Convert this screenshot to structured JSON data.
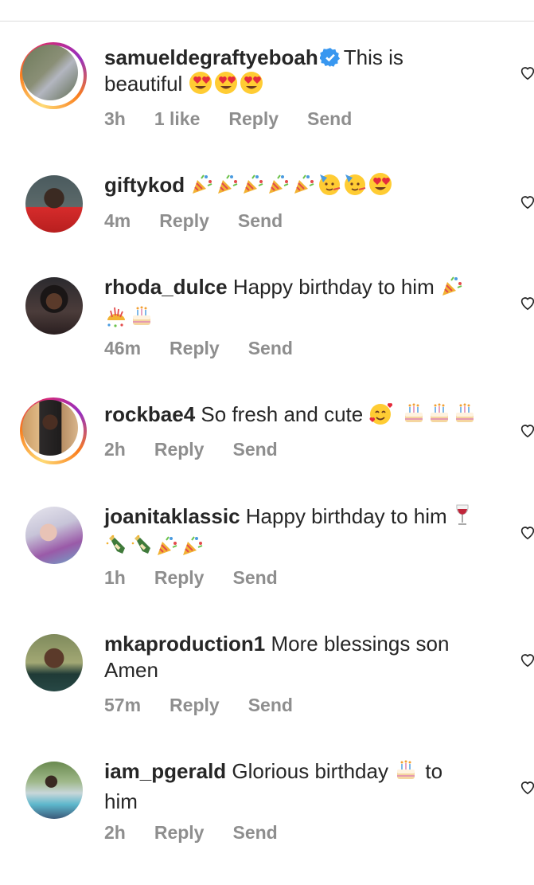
{
  "comments": [
    {
      "username": "samueldegraftyeboah",
      "verified": true,
      "text": "This is",
      "text2": "beautiful",
      "emojis": [
        "heart-eyes",
        "heart-eyes",
        "heart-eyes"
      ],
      "time": "3h",
      "likes": "1 like",
      "reply": "Reply",
      "send": "Send",
      "story_ring": true
    },
    {
      "username": "giftykod",
      "verified": false,
      "text": "",
      "emojis": [
        "party-popper",
        "party-popper",
        "party-popper",
        "party-popper",
        "party-popper",
        "partying-face",
        "partying-face",
        "heart-eyes"
      ],
      "time": "4m",
      "reply": "Reply",
      "send": "Send",
      "story_ring": false
    },
    {
      "username": "rhoda_dulce",
      "verified": false,
      "text": "Happy birthday to him",
      "emojis": [
        "party-popper",
        "confetti-ball",
        "birthday-cake"
      ],
      "time": "46m",
      "reply": "Reply",
      "send": "Send",
      "story_ring": false
    },
    {
      "username": "rockbae4",
      "verified": false,
      "text": "So fresh and cute",
      "emojis": [
        "smiling-hearts",
        "birthday-cake",
        "birthday-cake",
        "birthday-cake"
      ],
      "time": "2h",
      "reply": "Reply",
      "send": "Send",
      "story_ring": true
    },
    {
      "username": "joanitaklassic",
      "verified": false,
      "text": "Happy birthday to him",
      "emojis": [
        "wine-glass",
        "champagne",
        "champagne",
        "party-popper",
        "party-popper"
      ],
      "time": "1h",
      "reply": "Reply",
      "send": "Send",
      "story_ring": false
    },
    {
      "username": "mkaproduction1",
      "verified": false,
      "text": "More blessings son",
      "text2": "Amen",
      "emojis": [],
      "time": "57m",
      "reply": "Reply",
      "send": "Send",
      "story_ring": false
    },
    {
      "username": "iam_pgerald",
      "verified": false,
      "text": "Glorious birthday",
      "text_after": "to",
      "text2": "him",
      "emojis": [
        "birthday-cake"
      ],
      "time": "2h",
      "reply": "Reply",
      "send": "Send",
      "story_ring": false
    }
  ]
}
